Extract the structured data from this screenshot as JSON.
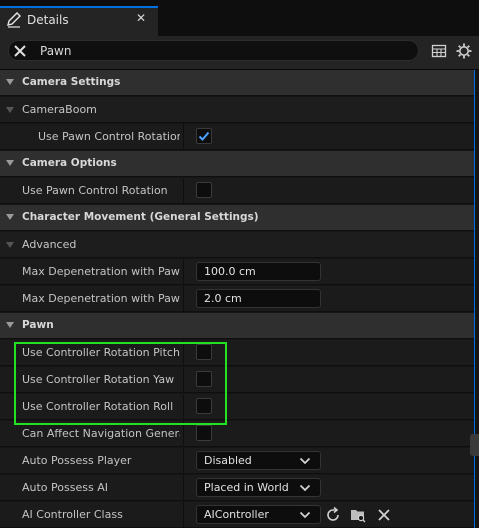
{
  "tab": {
    "title": "Details",
    "icon": "edit-pencil-icon",
    "close_glyph": "✕"
  },
  "search": {
    "value": "Pawn",
    "clear_icon": "close-icon"
  },
  "toolbar": {
    "table_icon": "grid-table-icon",
    "settings_icon": "gear-icon"
  },
  "colors": {
    "accent": "#0070e0",
    "checkmark": "#4aa3ff",
    "highlight": "#22e022"
  },
  "rows": {
    "camera_settings": {
      "label": "Camera Settings"
    },
    "camera_boom": {
      "label": "CameraBoom"
    },
    "boom_use_pawn_control_rotation": {
      "label": "Use Pawn Control Rotation",
      "checked": true
    },
    "camera_options": {
      "label": "Camera Options"
    },
    "cam_use_pawn_control_rotation": {
      "label": "Use Pawn Control Rotation",
      "checked": false
    },
    "character_movement": {
      "label": "Character Movement (General Settings)"
    },
    "advanced": {
      "label": "Advanced"
    },
    "max_depen_pawn": {
      "label": "Max Depenetration with Pawn",
      "value": "100.0 cm"
    },
    "max_depen_pawn2": {
      "label": "Max Depenetration with Pawn...",
      "value": "2.0 cm"
    },
    "pawn": {
      "label": "Pawn"
    },
    "use_ctrl_pitch": {
      "label": "Use Controller Rotation Pitch",
      "checked": false
    },
    "use_ctrl_yaw": {
      "label": "Use Controller Rotation Yaw",
      "checked": false
    },
    "use_ctrl_roll": {
      "label": "Use Controller Rotation Roll",
      "checked": false
    },
    "can_affect_nav": {
      "label": "Can Affect Navigation Generat...",
      "checked": false
    },
    "auto_possess_player": {
      "label": "Auto Possess Player",
      "value": "Disabled"
    },
    "auto_possess_ai": {
      "label": "Auto Possess AI",
      "value": "Placed in World"
    },
    "ai_controller_class": {
      "label": "AI Controller Class",
      "value": "AIController",
      "icons": [
        "reset-arrow-icon",
        "browse-folder-icon",
        "clear-icon"
      ]
    }
  }
}
